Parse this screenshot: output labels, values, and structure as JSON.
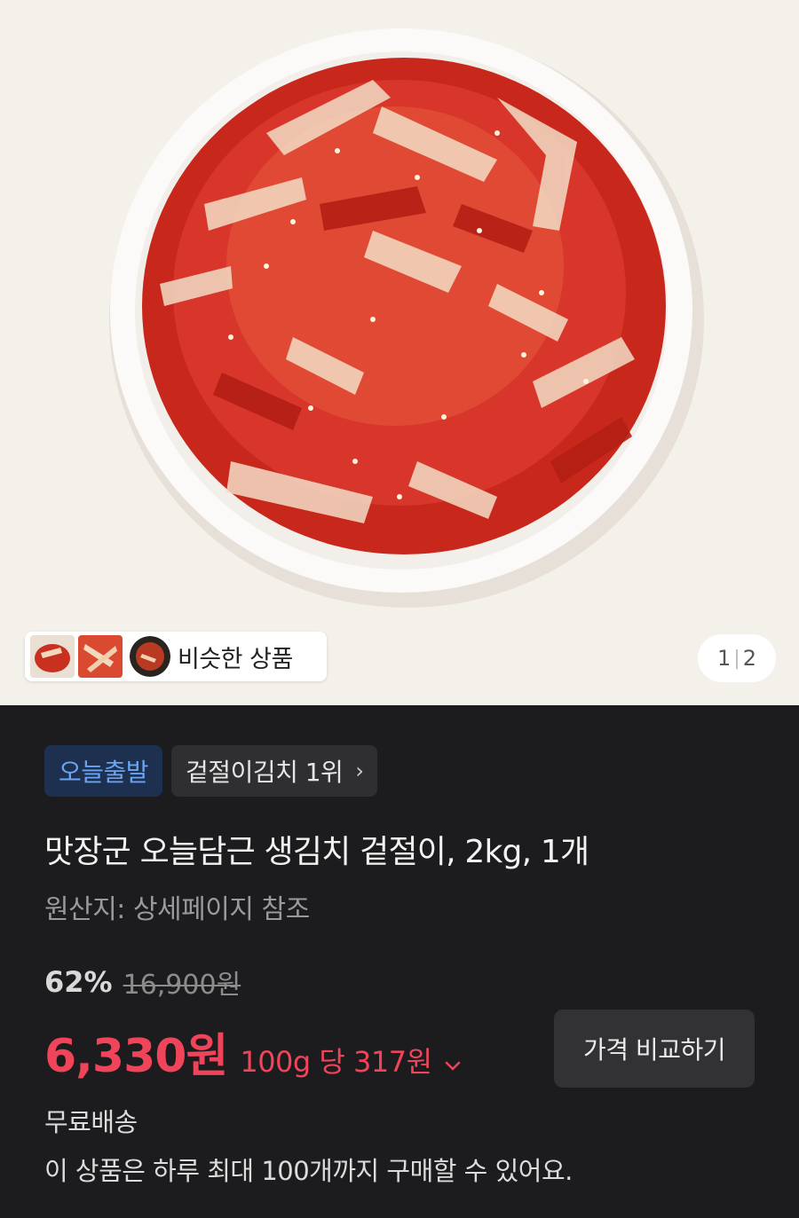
{
  "hero": {
    "photo_icon": "kimchi-plate-photo",
    "similar_label": "비슷한 상품",
    "pager_current": "1",
    "pager_total": "2"
  },
  "badges": {
    "today_ship": "오늘출발",
    "rank": "겉절이김치 1위",
    "rank_chevron_icon": "chevron-right-icon"
  },
  "product": {
    "title": "맛장군 오늘담근 생김치 겉절이, 2kg, 1개",
    "origin": "원산지: 상세페이지 참조"
  },
  "pricing": {
    "discount": "62%",
    "original_price": "16,900원",
    "sale_price": "6,330원",
    "unit_price": "100g 당 317원",
    "compare_button": "가격 비교하기"
  },
  "delivery": {
    "shipping": "무료배송",
    "limit_notice": "이 상품은 하루 최대 100개까지 구매할 수 있어요."
  },
  "colors": {
    "sale_red": "#f0445a",
    "badge_blue_text": "#6aa4f2",
    "badge_blue_bg": "#1e3050",
    "dark_bg": "#1c1c1e"
  }
}
